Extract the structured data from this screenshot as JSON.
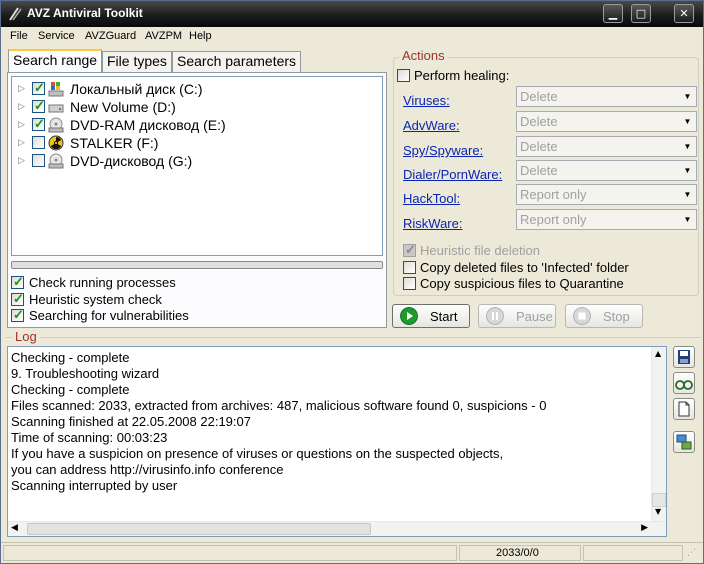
{
  "app": {
    "title": "AVZ Antiviral Toolkit",
    "accent_title_bar": "#1c1c1c",
    "link_color": "#0a24b3",
    "group_title_color": "#a0332a"
  },
  "title_buttons": {
    "minimize": "▁",
    "maximize": "□",
    "close": "✕"
  },
  "menu": [
    "File",
    "Service",
    "AVZGuard",
    "AVZPM",
    "Help"
  ],
  "tabs": {
    "search_range": "Search range",
    "file_types": "File types",
    "search_parameters": "Search parameters",
    "active": "search_range"
  },
  "drives": [
    {
      "label": "Локальный диск (C:)",
      "checked": true,
      "icon": "windows-drive-icon"
    },
    {
      "label": "New Volume (D:)",
      "checked": true,
      "icon": "hard-drive-icon"
    },
    {
      "label": "DVD-RAM дисковод (E:)",
      "checked": true,
      "icon": "dvd-drive-icon"
    },
    {
      "label": "STALKER (F:)",
      "checked": false,
      "icon": "radiation-disc-icon"
    },
    {
      "label": "DVD-дисковод (G:)",
      "checked": false,
      "icon": "dvd-drive-icon"
    }
  ],
  "scan_options": [
    {
      "label": "Check running processes",
      "checked": true
    },
    {
      "label": "Heuristic system check",
      "checked": true
    },
    {
      "label": "Searching for vulnerabilities",
      "checked": true
    }
  ],
  "actions": {
    "group_title": "Actions",
    "perform_healing": {
      "label": "Perform healing:",
      "checked": false
    },
    "rows": [
      {
        "label": "Viruses:",
        "value": "Delete"
      },
      {
        "label": "AdvWare:",
        "value": "Delete"
      },
      {
        "label": "Spy/Spyware:",
        "value": "Delete"
      },
      {
        "label": "Dialer/PornWare:",
        "value": "Delete"
      },
      {
        "label": "HackTool:",
        "value": "Report only"
      },
      {
        "label": "RiskWare:",
        "value": "Report only"
      }
    ],
    "checkboxes": [
      {
        "label": "Heuristic file deletion",
        "checked": true,
        "disabled": true
      },
      {
        "label": "Copy deleted files to 'Infected' folder",
        "checked": false,
        "disabled": false
      },
      {
        "label": "Copy suspicious files to Quarantine",
        "checked": false,
        "disabled": false
      }
    ]
  },
  "buttons": {
    "start": "Start",
    "pause": "Pause",
    "stop": "Stop"
  },
  "log": {
    "group_title": "Log",
    "lines": [
      "Checking - complete",
      "9. Troubleshooting wizard",
      "Checking - complete",
      "Files scanned: 2033, extracted from archives: 487, malicious software found 0, suspicions - 0",
      "Scanning finished at 22.05.2008 22:19:07",
      "Time of scanning: 00:03:23",
      "If you have a suspicion on presence of viruses or questions on the suspected objects,",
      "you can address http://virusinfo.info conference",
      "Scanning interrupted by user"
    ]
  },
  "side_tools": [
    "save-log-icon",
    "glasses-icon",
    "blank-page-icon",
    "network-icon"
  ],
  "status": {
    "counter": "2033/0/0"
  }
}
